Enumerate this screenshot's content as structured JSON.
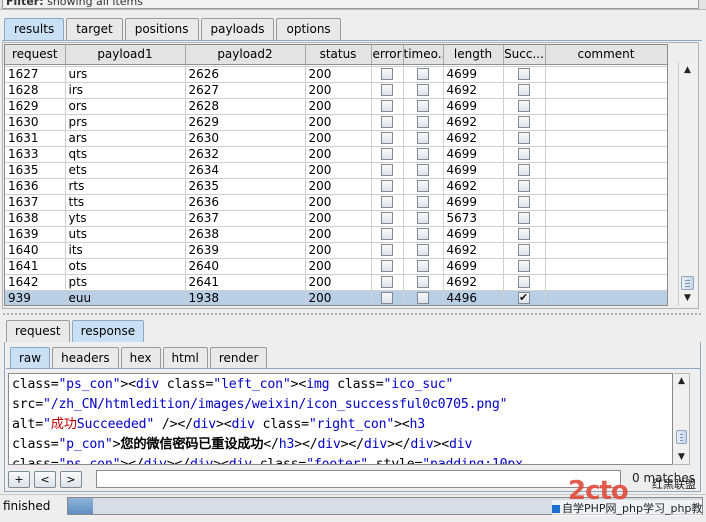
{
  "filter": {
    "label": "Filter:",
    "text": "showing all items"
  },
  "main_tabs": [
    {
      "label": "results",
      "active": true
    },
    {
      "label": "target",
      "active": false
    },
    {
      "label": "positions",
      "active": false
    },
    {
      "label": "payloads",
      "active": false
    },
    {
      "label": "options",
      "active": false
    }
  ],
  "table": {
    "columns": [
      "request",
      "payload1",
      "payload2",
      "status",
      "error",
      "timeo...",
      "length",
      "Succ...",
      "comment"
    ],
    "rows": [
      {
        "request": "1627",
        "payload1": "urs",
        "payload2": "2626",
        "status": "200",
        "error": false,
        "timeout": false,
        "length": "4699",
        "success": false,
        "comment": ""
      },
      {
        "request": "1628",
        "payload1": "irs",
        "payload2": "2627",
        "status": "200",
        "error": false,
        "timeout": false,
        "length": "4692",
        "success": false,
        "comment": ""
      },
      {
        "request": "1629",
        "payload1": "ors",
        "payload2": "2628",
        "status": "200",
        "error": false,
        "timeout": false,
        "length": "4699",
        "success": false,
        "comment": ""
      },
      {
        "request": "1630",
        "payload1": "prs",
        "payload2": "2629",
        "status": "200",
        "error": false,
        "timeout": false,
        "length": "4692",
        "success": false,
        "comment": ""
      },
      {
        "request": "1631",
        "payload1": "ars",
        "payload2": "2630",
        "status": "200",
        "error": false,
        "timeout": false,
        "length": "4692",
        "success": false,
        "comment": ""
      },
      {
        "request": "1633",
        "payload1": "qts",
        "payload2": "2632",
        "status": "200",
        "error": false,
        "timeout": false,
        "length": "4699",
        "success": false,
        "comment": ""
      },
      {
        "request": "1635",
        "payload1": "ets",
        "payload2": "2634",
        "status": "200",
        "error": false,
        "timeout": false,
        "length": "4699",
        "success": false,
        "comment": ""
      },
      {
        "request": "1636",
        "payload1": "rts",
        "payload2": "2635",
        "status": "200",
        "error": false,
        "timeout": false,
        "length": "4692",
        "success": false,
        "comment": ""
      },
      {
        "request": "1637",
        "payload1": "tts",
        "payload2": "2636",
        "status": "200",
        "error": false,
        "timeout": false,
        "length": "4699",
        "success": false,
        "comment": ""
      },
      {
        "request": "1638",
        "payload1": "yts",
        "payload2": "2637",
        "status": "200",
        "error": false,
        "timeout": false,
        "length": "5673",
        "success": false,
        "comment": ""
      },
      {
        "request": "1639",
        "payload1": "uts",
        "payload2": "2638",
        "status": "200",
        "error": false,
        "timeout": false,
        "length": "4699",
        "success": false,
        "comment": ""
      },
      {
        "request": "1640",
        "payload1": "its",
        "payload2": "2639",
        "status": "200",
        "error": false,
        "timeout": false,
        "length": "4692",
        "success": false,
        "comment": ""
      },
      {
        "request": "1641",
        "payload1": "ots",
        "payload2": "2640",
        "status": "200",
        "error": false,
        "timeout": false,
        "length": "4699",
        "success": false,
        "comment": ""
      },
      {
        "request": "1642",
        "payload1": "pts",
        "payload2": "2641",
        "status": "200",
        "error": false,
        "timeout": false,
        "length": "4692",
        "success": false,
        "comment": ""
      },
      {
        "request": "939",
        "payload1": "euu",
        "payload2": "1938",
        "status": "200",
        "error": false,
        "timeout": false,
        "length": "4496",
        "success": true,
        "comment": "",
        "selected": true
      }
    ]
  },
  "rr_tabs": [
    {
      "label": "request",
      "active": false
    },
    {
      "label": "response",
      "active": true
    }
  ],
  "view_tabs": [
    {
      "label": "raw",
      "active": true
    },
    {
      "label": "headers",
      "active": false
    },
    {
      "label": "hex",
      "active": false
    },
    {
      "label": "html",
      "active": false
    },
    {
      "label": "render",
      "active": false
    }
  ],
  "response": {
    "l1": {
      "a": "class=",
      "b": "\"ps_con\"",
      "c": "><",
      "d": "div",
      "e": " class=",
      "f": "\"left_con\"",
      "g": "><",
      "h": "img",
      "i": " class=",
      "j": "\"ico_suc\""
    },
    "l2": {
      "a": "src=",
      "b": "\"/zh_CN/htmledition/images/weixin/icon_successful0c0705.png\""
    },
    "l3": {
      "a": "alt=",
      "b": "\"",
      "c": "成功",
      "d": "Succeeded\"",
      "e": " /></",
      "f": "div",
      "g": "><",
      "h": "div",
      "i": " class=",
      "j": "\"right_con\"",
      "k": "><",
      "l": "h3"
    },
    "l4": {
      "a": "class=",
      "b": "\"p_con\"",
      "c": ">",
      "d": "您的微信密码已重设成功",
      "e": "</",
      "f": "h3",
      "g": "></",
      "h": "div",
      "i": "></",
      "j": "div",
      "k": "></",
      "l": "div",
      "m": "><",
      "n": "div"
    },
    "l5": {
      "a": "class=",
      "b": "\"ps_con\"",
      "c": "></",
      "d": "div",
      "e": "></",
      "f": "div",
      "g": "><",
      "h": "div",
      "i": " class=",
      "j": "\"footer\"",
      "k": " style=",
      "l": "\"padding:10px"
    }
  },
  "search": {
    "buttons": [
      "+",
      "<",
      ">"
    ],
    "value": "",
    "matches": "0 matches"
  },
  "status": {
    "text": "finished",
    "progress": 0.04
  },
  "watermark": {
    "logo": "2cto",
    "brand": "红黑联盟",
    "line2": "自学PHP网_php学习_php教"
  }
}
